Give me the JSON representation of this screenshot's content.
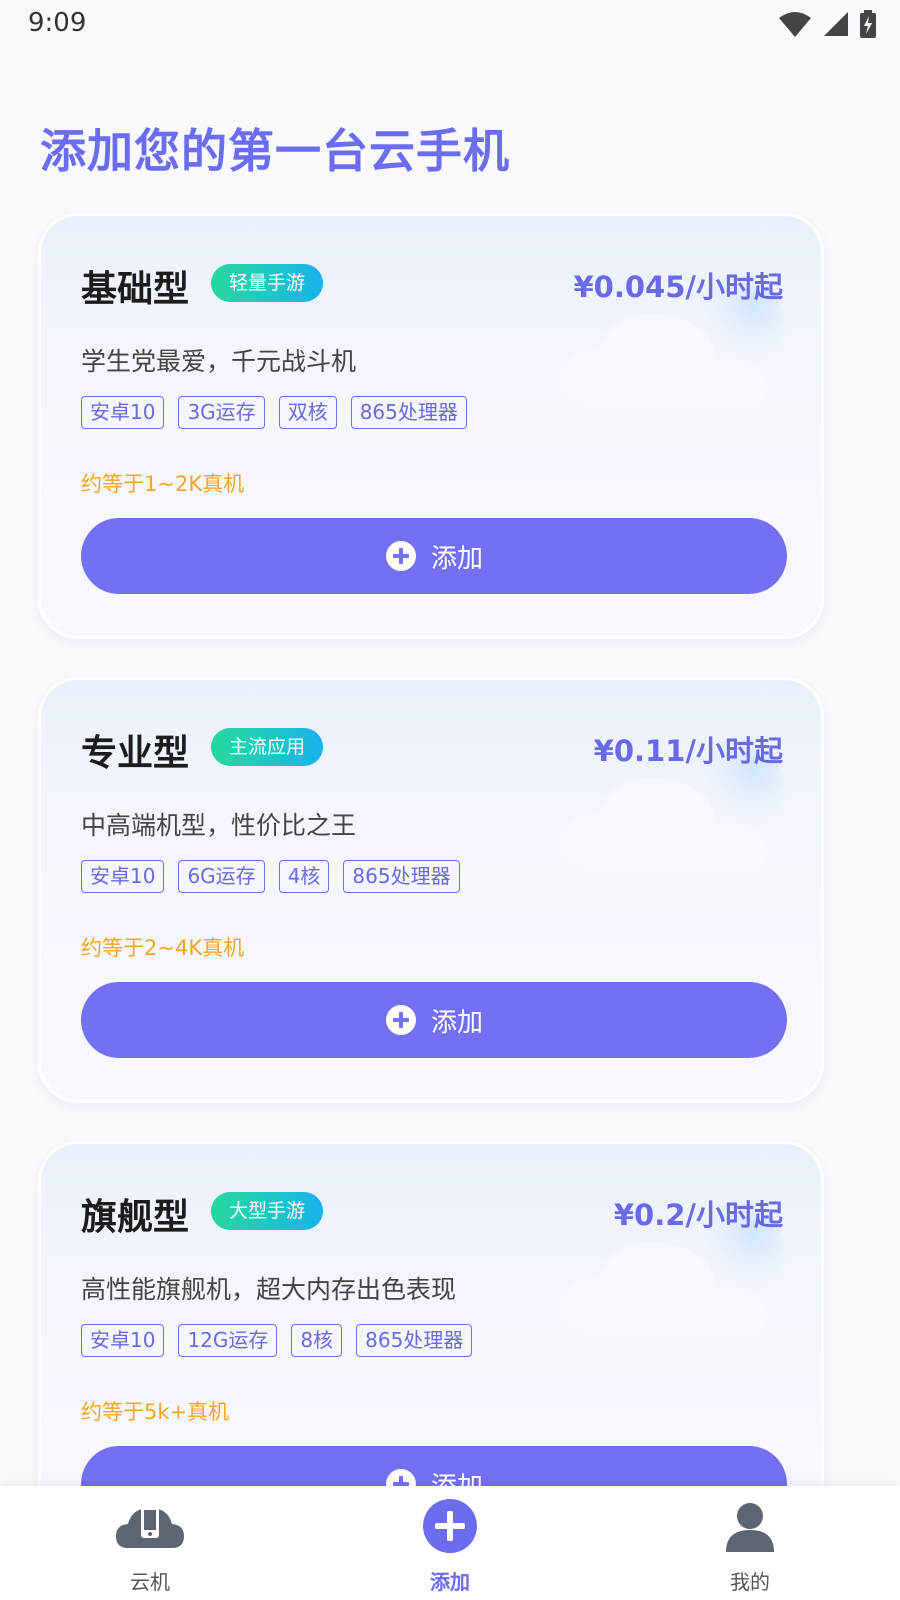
{
  "status_bar": {
    "time": "9:09"
  },
  "page": {
    "title": "添加您的第一台云手机"
  },
  "colors": {
    "accent": "#7370f3",
    "price": "#6a6ae8",
    "equiv": "#f5a524"
  },
  "cards": [
    {
      "name": "基础型",
      "badge": "轻量手游",
      "price": "¥0.045/小时起",
      "desc": "学生党最爱，千元战斗机",
      "tags": [
        "安卓10",
        "3G运存",
        "双核",
        "865处理器"
      ],
      "equiv": "约等于1~2K真机",
      "add_label": "添加"
    },
    {
      "name": "专业型",
      "badge": "主流应用",
      "price": "¥0.11/小时起",
      "desc": "中高端机型，性价比之王",
      "tags": [
        "安卓10",
        "6G运存",
        "4核",
        "865处理器"
      ],
      "equiv": "约等于2~4K真机",
      "add_label": "添加"
    },
    {
      "name": "旗舰型",
      "badge": "大型手游",
      "price": "¥0.2/小时起",
      "desc": "高性能旗舰机，超大内存出色表现",
      "tags": [
        "安卓10",
        "12G运存",
        "8核",
        "865处理器"
      ],
      "equiv": "约等于5k+真机",
      "add_label": "添加"
    }
  ],
  "nav": [
    {
      "label": "云机",
      "icon": "cloud-phone-icon",
      "active": false
    },
    {
      "label": "添加",
      "icon": "add-circle-icon",
      "active": true
    },
    {
      "label": "我的",
      "icon": "user-icon",
      "active": false
    }
  ]
}
